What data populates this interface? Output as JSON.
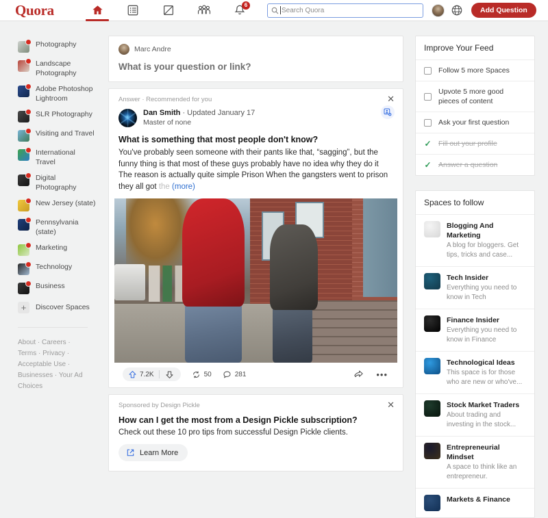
{
  "header": {
    "logo": "Quora",
    "nav": [
      {
        "name": "home",
        "icon": "home-icon",
        "active": true
      },
      {
        "name": "answers",
        "icon": "list-icon",
        "active": false
      },
      {
        "name": "write",
        "icon": "edit-icon",
        "active": false
      },
      {
        "name": "spaces",
        "icon": "people-icon",
        "active": false
      },
      {
        "name": "notifications",
        "icon": "bell-icon",
        "active": false,
        "badge": "6"
      }
    ],
    "search": {
      "placeholder": "Search Quora",
      "value": "",
      "icon": "search-icon"
    },
    "profile_icon": "avatar",
    "language_icon": "globe-icon",
    "add_question_label": "Add Question"
  },
  "sidebar": {
    "spaces": [
      {
        "label": "Photography",
        "color1": "#cfd3cf",
        "color2": "#7d8b7a"
      },
      {
        "label": "Landscape Photography",
        "color1": "#b8453c",
        "color2": "#d9cfc4"
      },
      {
        "label": "Adobe Photoshop Lightroom",
        "color1": "#2b4b8c",
        "color2": "#12294f"
      },
      {
        "label": "SLR Photography",
        "color1": "#4a4a4a",
        "color2": "#1c1c1c"
      },
      {
        "label": "Visiting and Travel",
        "color1": "#79b4d6",
        "color2": "#3d7a59"
      },
      {
        "label": "International Travel",
        "color1": "#3fa34d",
        "color2": "#2e7fc2"
      },
      {
        "label": "Digital Photography",
        "color1": "#3b3b3b",
        "color2": "#151515"
      },
      {
        "label": "New Jersey (state)",
        "color1": "#f0c93f",
        "color2": "#c99a22"
      },
      {
        "label": "Pennsylvania (state)",
        "color1": "#1f3f7a",
        "color2": "#0f2247"
      },
      {
        "label": "Marketing",
        "color1": "#8ec63f",
        "color2": "#d9e8c2"
      },
      {
        "label": "Technology",
        "color1": "#2a2a2a",
        "color2": "#9fb7cf"
      },
      {
        "label": "Business",
        "color1": "#3a3a3a",
        "color2": "#111111"
      }
    ],
    "discover_label": "Discover Spaces",
    "discover_icon": "plus-icon",
    "footer_links": [
      "About",
      "Careers",
      "Terms",
      "Privacy",
      "Acceptable Use",
      "Businesses",
      "Your Ad Choices"
    ]
  },
  "ask_box": {
    "user_name": "Marc Andre",
    "prompt": "What is your question or link?"
  },
  "answer": {
    "meta": "Answer · Recommended for you",
    "close_icon": "close-icon",
    "follow_icon": "add-person-icon",
    "author": "Dan Smith",
    "author_meta": " · Updated January 17",
    "author_credential": "Master of none",
    "title": "What is something that most people don't know?",
    "body": "You've probably seen someone with their pants like that, “sagging”, but the funny thing is that most of these guys probably have no idea why they do it The reason is actually quite simple Prison When the gangsters went to prison they all got",
    "body_fade": "the",
    "more_label": "(more)",
    "actions": {
      "upvote_icon": "upvote-icon",
      "upvote_count": "7.2K",
      "downvote_icon": "downvote-icon",
      "repost_icon": "repost-icon",
      "repost_count": "50",
      "comment_icon": "comment-icon",
      "comment_count": "281",
      "share_icon": "share-icon",
      "more_icon": "more-options-icon"
    }
  },
  "sponsored": {
    "tag": "Sponsored by Design Pickle",
    "close_icon": "close-icon",
    "title": "How can I get the most from a Design Pickle subscription?",
    "description": "Check out these 10 pro tips from successful Design Pickle clients.",
    "cta_label": "Learn More",
    "cta_icon": "external-link-icon"
  },
  "improve_feed": {
    "title": "Improve Your Feed",
    "items": [
      {
        "label": "Follow 5 more Spaces",
        "done": false
      },
      {
        "label": "Upvote 5 more good pieces of content",
        "done": false
      },
      {
        "label": "Ask your first question",
        "done": false
      },
      {
        "label": "Fill out your profile",
        "done": true
      },
      {
        "label": "Answer a question",
        "done": true
      }
    ],
    "check_icon": "check-icon"
  },
  "spaces_to_follow": {
    "title": "Spaces to follow",
    "items": [
      {
        "name": "Blogging And Marketing",
        "desc": "A blog for bloggers. Get tips, tricks and case...",
        "color1": "#f4f4f4",
        "color2": "#d8d8d8"
      },
      {
        "name": "Tech Insider",
        "desc": "Everything you need to know in Tech",
        "color1": "#1d5f7a",
        "color2": "#12394a"
      },
      {
        "name": "Finance Insider",
        "desc": "Everything you need to know in Finance",
        "color1": "#2b2b2b",
        "color2": "#000000"
      },
      {
        "name": "Technological Ideas",
        "desc": "This space is for those who are new or who've...",
        "color1": "#2f9ae0",
        "color2": "#0d4f86"
      },
      {
        "name": "Stock Market Traders",
        "desc": "About trading and investing in the stock...",
        "color1": "#1d3a2b",
        "color2": "#07140d"
      },
      {
        "name": "Entrepreneurial Mindset",
        "desc": "A space to think like an entrepreneur.",
        "color1": "#1a1a2e",
        "color2": "#3c2f1a"
      },
      {
        "name": "Markets & Finance",
        "desc": "",
        "color1": "#2a4d78",
        "color2": "#123055"
      }
    ]
  },
  "theme": {
    "brand_red": "#b92b27",
    "page_bg": "#f1f2f2",
    "upvote_blue": "#2e69e0",
    "link_blue": "#2f6fd0",
    "check_green": "#2e9b57"
  }
}
